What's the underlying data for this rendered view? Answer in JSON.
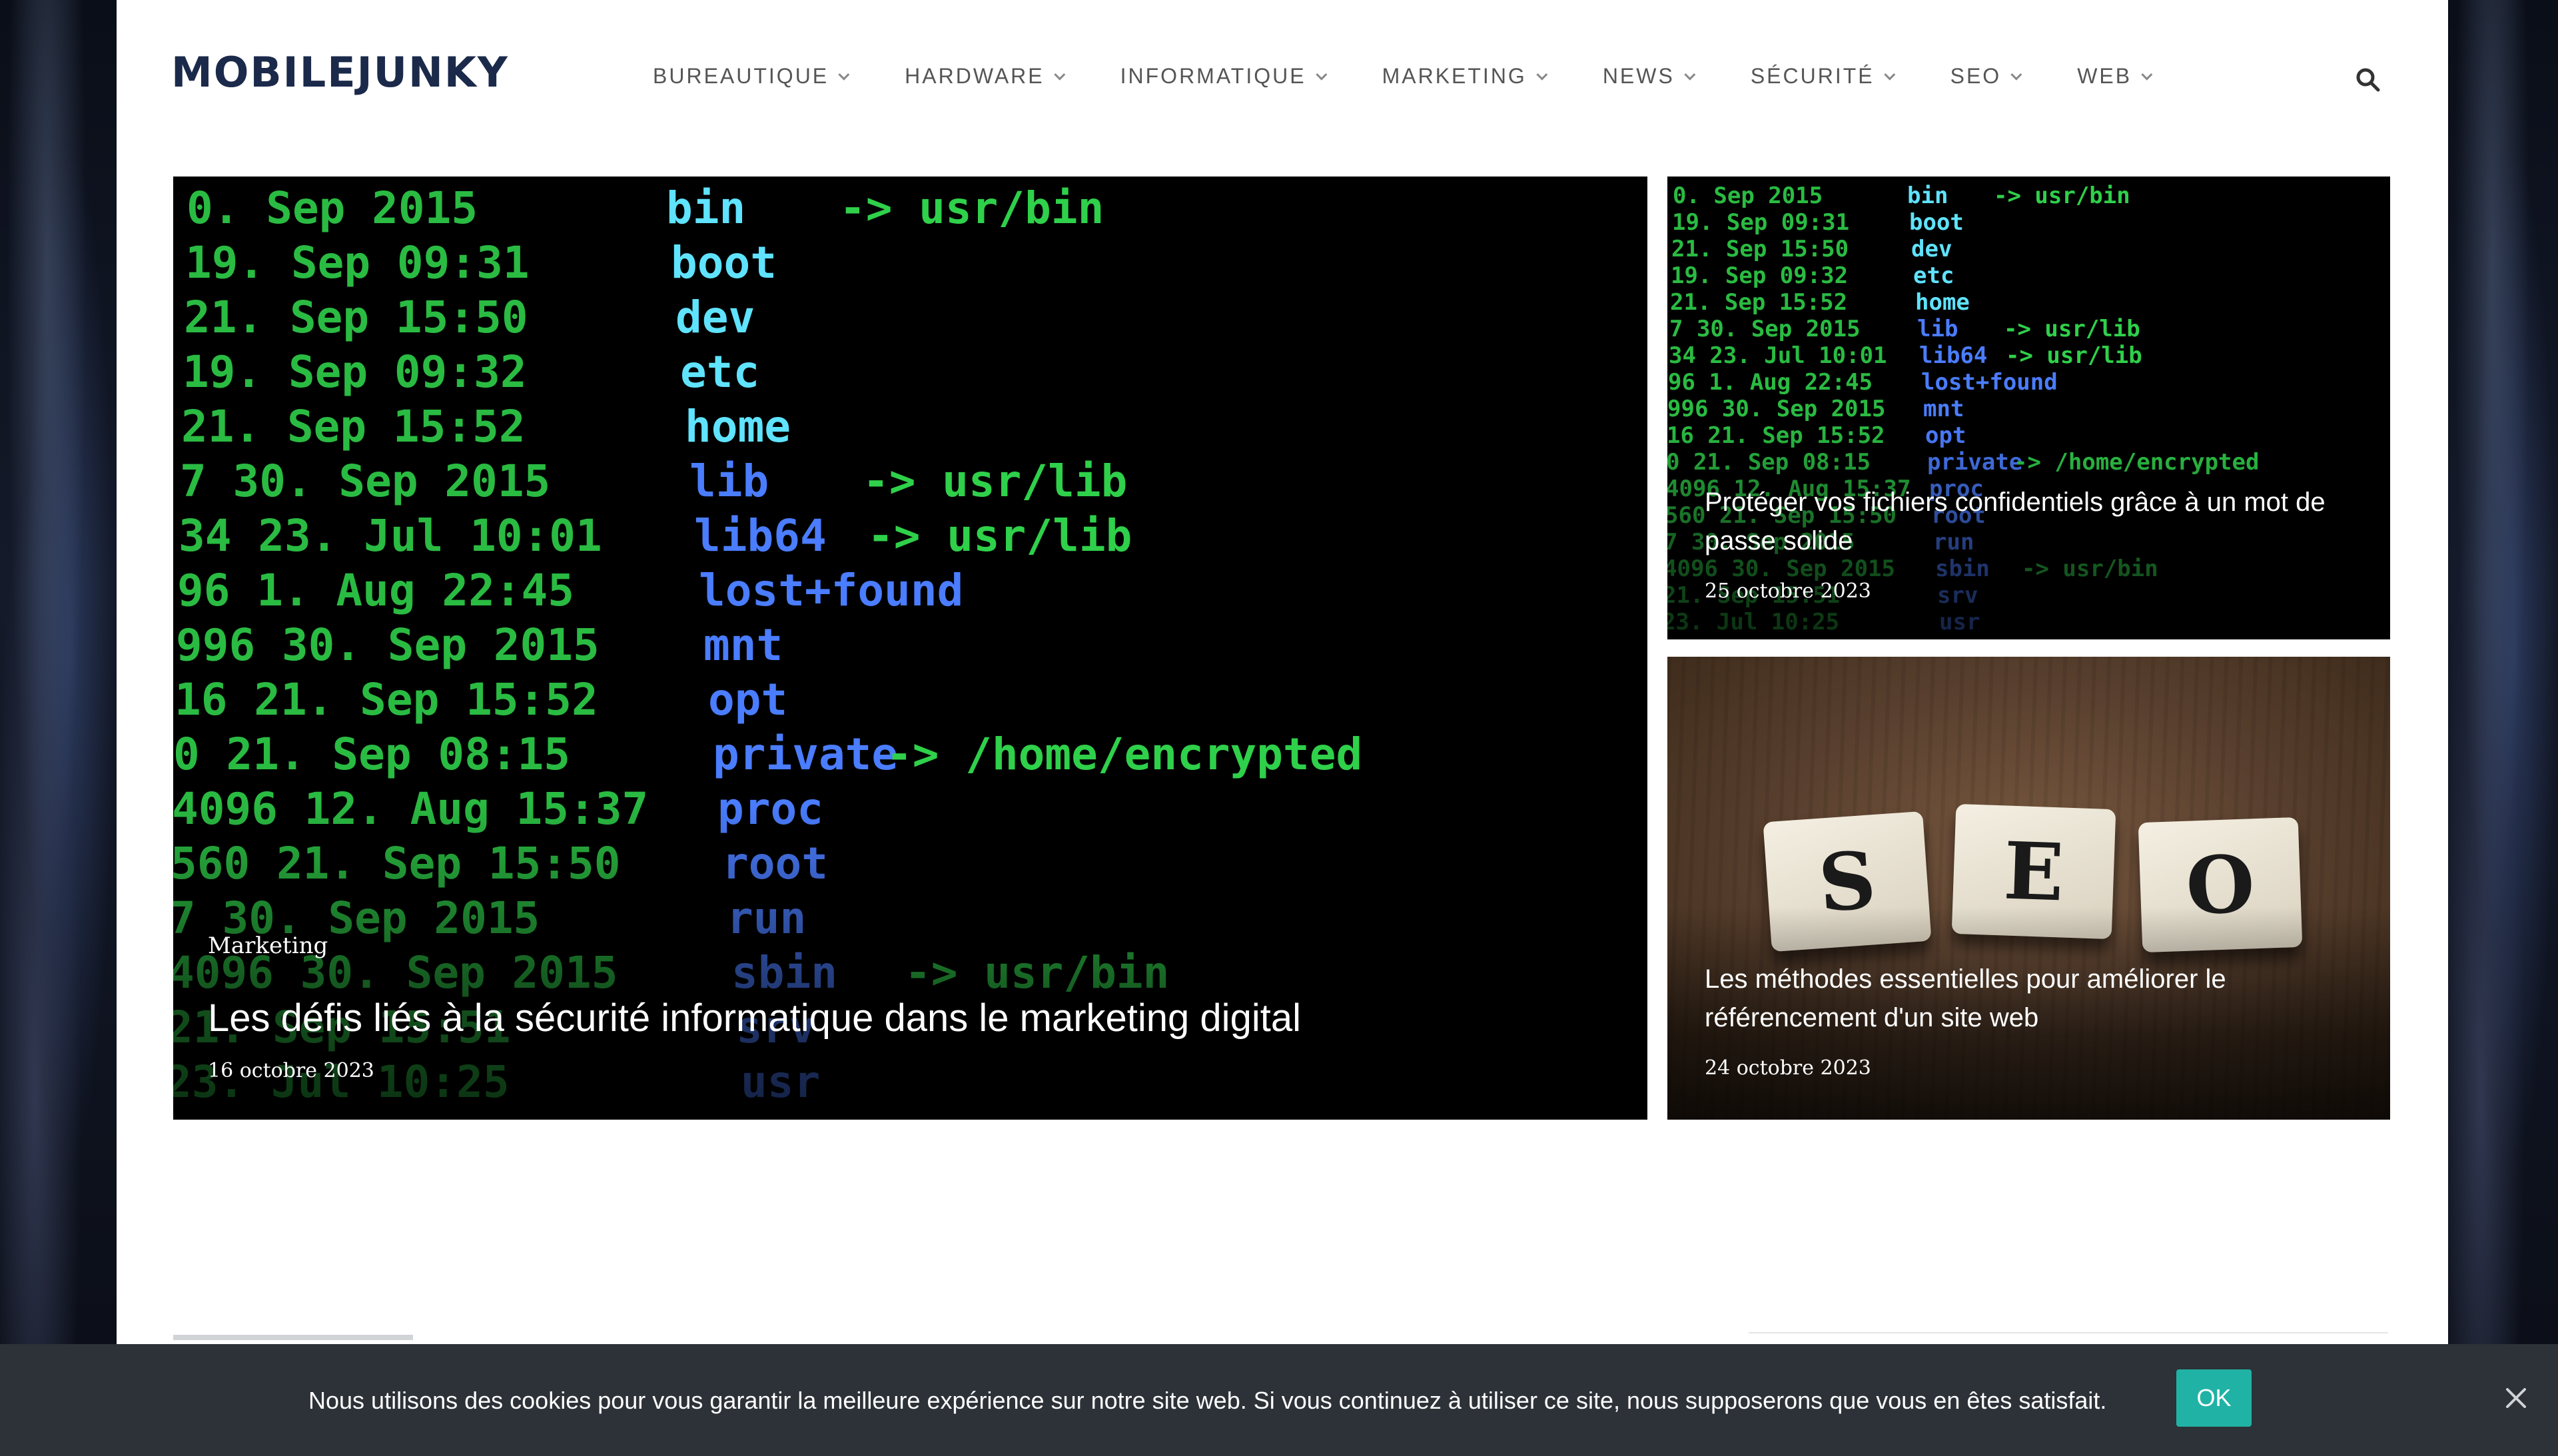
{
  "site": {
    "logo": "MOBILEJUNKY"
  },
  "nav": {
    "items": [
      {
        "label": "BUREAUTIQUE"
      },
      {
        "label": "HARDWARE"
      },
      {
        "label": "INFORMATIQUE"
      },
      {
        "label": "MARKETING"
      },
      {
        "label": "NEWS"
      },
      {
        "label": "SÉCURITÉ"
      },
      {
        "label": "SEO"
      },
      {
        "label": "WEB"
      }
    ],
    "search_icon": "search-icon",
    "dropdown_icon": "chevron-down-icon"
  },
  "hero": {
    "category": "Marketing",
    "title": "Les défis liés à la sécurité informatique dans le marketing digital",
    "date": "16 octobre 2023",
    "image_lines": [
      [
        "0. Sep 2015",
        "bin",
        "-> usr/bin"
      ],
      [
        "19. Sep 09:31",
        "boot",
        ""
      ],
      [
        "21. Sep 15:50",
        "dev",
        ""
      ],
      [
        "19. Sep 09:32",
        "etc",
        ""
      ],
      [
        "21. Sep 15:52",
        "home",
        ""
      ],
      [
        "7 30. Sep 2015",
        "lib",
        "-> usr/lib"
      ],
      [
        "34 23. Jul 10:01",
        "lib64",
        "-> usr/lib"
      ],
      [
        "96 1. Aug 22:45",
        "lost+found",
        ""
      ],
      [
        "996 30. Sep 2015",
        "mnt",
        ""
      ],
      [
        "16 21. Sep 15:52",
        "opt",
        ""
      ],
      [
        "0 21. Sep 08:15",
        "private",
        "-> /home/encrypted"
      ],
      [
        "4096 12. Aug 15:37",
        "proc",
        ""
      ],
      [
        "560 21. Sep 15:50",
        "root",
        ""
      ],
      [
        "7 30. Sep 2015",
        "run",
        ""
      ],
      [
        "4096 30. Sep 2015",
        "sbin",
        "-> usr/bin"
      ],
      [
        "21. Sep 15:51",
        "srv",
        ""
      ],
      [
        "23. Jul 10:25",
        "usr",
        ""
      ]
    ]
  },
  "side_articles": [
    {
      "title": "Protéger vos fichiers confidentiels grâce à un mot de passe solide",
      "date": "25 octobre 2023"
    },
    {
      "title": "Les méthodes essentielles pour améliorer le référencement d'un site web",
      "date": "24 octobre 2023",
      "tiles": [
        "S",
        "E",
        "O"
      ]
    }
  ],
  "cookie": {
    "text": "Nous utilisons des cookies pour vous garantir la meilleure expérience sur notre site web. Si vous continuez à utiliser ce site, nous supposerons que vous en êtes satisfait.",
    "ok_label": "OK",
    "close_icon": "close-icon"
  },
  "colors": {
    "terminal_green": "#2fd04a",
    "terminal_blue": "#4a7dff",
    "terminal_cyan": "#5fe3ff",
    "cookie_bg": "#2d3238",
    "ok_button": "#20b2a5",
    "logo": "#1b2a4a"
  }
}
